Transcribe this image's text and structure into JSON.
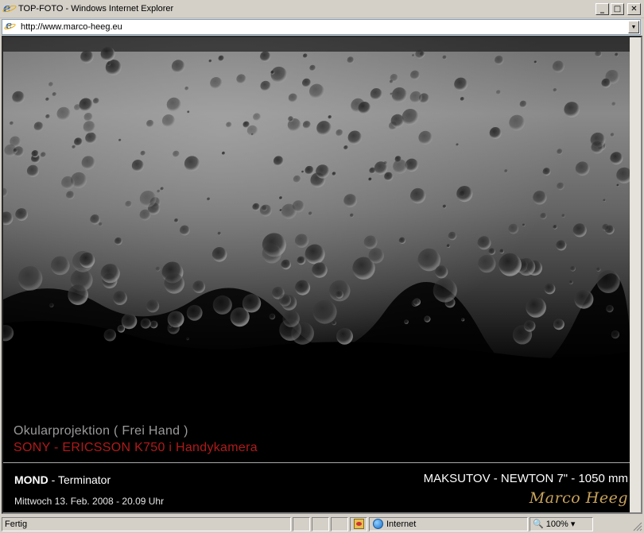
{
  "window": {
    "title": "TOP-FOTO - Windows Internet Explorer",
    "minimize_glyph": "_",
    "maximize_glyph": "□",
    "close_glyph": "✕"
  },
  "addressbar": {
    "url": "http://www.marco-heeg.eu",
    "dropdown_glyph": "▼"
  },
  "page": {
    "ocular_text": "Okularprojektion ( Frei Hand )",
    "camera_text": "SONY - ERICSSON K750 i Handykamera",
    "mond_bold": "MOND",
    "mond_rest": " - Terminator",
    "date_text": "Mittwoch 13. Feb. 2008 - 20.09 Uhr",
    "scope_text": "MAKSUTOV - NEWTON 7\" - 1050 mm",
    "signature": "Marco Heeg",
    "colors": {
      "camera": "#b01a1a",
      "signature": "#c9a35b",
      "ocular": "#9a9a9a"
    }
  },
  "statusbar": {
    "status_text": "Fertig",
    "zone_text": "Internet",
    "zoom_text": "100%",
    "zoom_dropdown_glyph": "▾"
  },
  "icons": [
    "ie-logo-icon",
    "page-icon",
    "privacy-icon",
    "globe-icon",
    "zoom-icon",
    "resize-grip-icon"
  ]
}
